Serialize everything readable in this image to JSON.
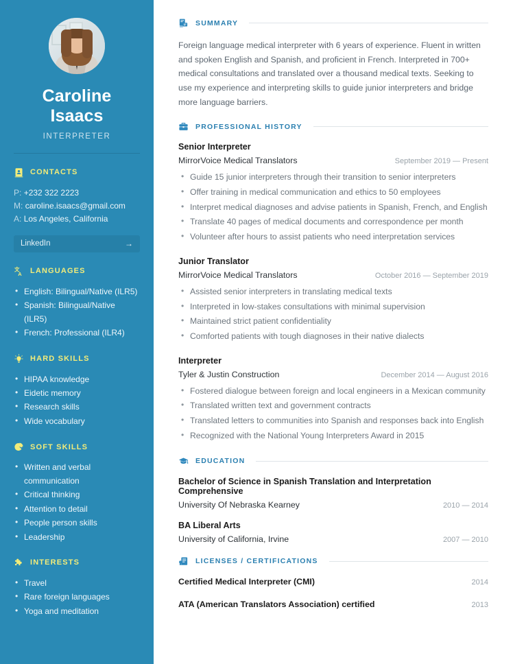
{
  "theme": {
    "sidebar_bg": "#2a8ab5",
    "sidebar_heading": "#f2ec7a",
    "accent_blue": "#2a7fb0",
    "body_text": "#6d767e"
  },
  "profile": {
    "name": "Caroline Isaacs",
    "title": "INTERPRETER",
    "photo_alt": "portrait-photo"
  },
  "sidebar": {
    "contacts": {
      "heading": "CONTACTS",
      "icon": "contact-card-icon",
      "phone_key": "P:",
      "phone": "+232 322 2223",
      "email_key": "M:",
      "email": "caroline.isaacs@gmail.com",
      "address_key": "A:",
      "address": "Los Angeles, California",
      "link_label": "LinkedIn",
      "link_arrow": "→"
    },
    "languages": {
      "heading": "LANGUAGES",
      "icon": "translate-icon",
      "items": [
        "English: Bilingual/Native (ILR5)",
        "Spanish: Bilingual/Native (ILR5)",
        "French: Professional (ILR4)"
      ]
    },
    "hard_skills": {
      "heading": "HARD SKILLS",
      "icon": "lightbulb-icon",
      "items": [
        "HIPAA knowledge",
        "Eidetic memory",
        "Research skills",
        "Wide vocabulary"
      ]
    },
    "soft_skills": {
      "heading": "SOFT SKILLS",
      "icon": "pie-chart-icon",
      "items": [
        "Written and verbal communication",
        "Critical thinking",
        "Attention to detail",
        "People person skills",
        "Leadership"
      ]
    },
    "interests": {
      "heading": "INTERESTS",
      "icon": "puzzle-piece-icon",
      "items": [
        "Travel",
        "Rare foreign languages",
        "Yoga and meditation"
      ]
    }
  },
  "main": {
    "summary": {
      "heading": "SUMMARY",
      "icon": "document-summary-icon",
      "text": "Foreign language medical interpreter with 6 years of experience. Fluent in written and spoken English and Spanish, and proficient in French. Interpreted in 700+ medical consultations and translated over a thousand medical texts. Seeking to use my experience and interpreting skills to guide junior interpreters and bridge more language barriers."
    },
    "professional_history": {
      "heading": "PROFESSIONAL HISTORY",
      "icon": "briefcase-icon",
      "entries": [
        {
          "title": "Senior Interpreter",
          "org": "MirrorVoice Medical Translators",
          "date": "September 2019 — Present",
          "bullets": [
            "Guide 15 junior interpreters through their transition to senior interpreters",
            "Offer training in medical communication and ethics to 50 employees",
            "Interpret medical diagnoses and advise patients in Spanish, French, and English",
            "Translate 40 pages of medical documents and correspondence per month",
            "Volunteer after hours to assist patients who need interpretation services"
          ]
        },
        {
          "title": "Junior Translator",
          "org": "MirrorVoice Medical Translators",
          "date": "October 2016 — September 2019",
          "bullets": [
            "Assisted senior interpreters in translating medical texts",
            "Interpreted in low-stakes consultations with minimal supervision",
            "Maintained strict patient confidentiality",
            "Comforted patients with tough diagnoses in their native dialects"
          ]
        },
        {
          "title": "Interpreter",
          "org": "Tyler & Justin Construction",
          "date": "December 2014 — August 2016",
          "bullets": [
            "Fostered dialogue between foreign and local engineers in a Mexican community",
            "Translated written text and government contracts",
            "Translated letters to communities into Spanish and responses back into English",
            "Recognized with the National Young Interpreters Award in 2015"
          ]
        }
      ]
    },
    "education": {
      "heading": "EDUCATION",
      "icon": "graduation-cap-icon",
      "entries": [
        {
          "degree": "Bachelor of Science in Spanish Translation and Interpretation Comprehensive",
          "school": "University Of Nebraska Kearney",
          "date": "2010 — 2014"
        },
        {
          "degree": "BA Liberal Arts",
          "school": "University of California, Irvine",
          "date": "2007 — 2010"
        }
      ]
    },
    "licenses": {
      "heading": "LICENSES / CERTIFICATIONS",
      "icon": "certificate-icon",
      "entries": [
        {
          "name": "Certified Medical Interpreter (CMI)",
          "date": "2014"
        },
        {
          "name": "ATA (American Translators Association) certified",
          "date": "2013"
        }
      ]
    }
  }
}
